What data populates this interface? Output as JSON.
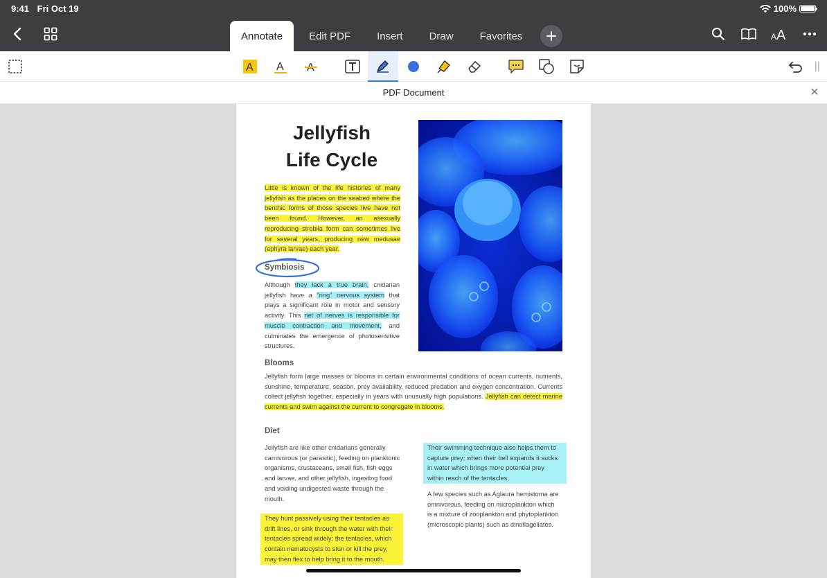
{
  "status": {
    "time": "9:41",
    "date": "Fri Oct 19",
    "battery": "100%"
  },
  "nav": {
    "tabs": [
      {
        "label": "Annotate",
        "active": true
      },
      {
        "label": "Edit PDF"
      },
      {
        "label": "Insert"
      },
      {
        "label": "Draw"
      },
      {
        "label": "Favorites"
      }
    ]
  },
  "docbar": {
    "title": "PDF Document"
  },
  "doc": {
    "title_line1": "Jellyfish",
    "title_line2": "Life Cycle",
    "intro": "Little is known of the life histories of many jellyfish as the places on the seabed where the benthic forms of those species live have not been found. However, an asexually reproducing strobila form can sometimes live for several years, producing new medusae (ephyra larvae) each year.",
    "symbiosis_head": "Symbiosis",
    "sym_a": "Although ",
    "sym_b": "they lack a true brain,",
    "sym_c": " cnidarian jellyfish have a ",
    "sym_d": "\"ring\" nervous system",
    "sym_e": " that plays a significant role in motor and sensory activity. This ",
    "sym_f": "net of nerves is responsible for muscle contraction and movement,",
    "sym_g": " and culminates the emergence of photosensitive structures.",
    "blooms_head": "Blooms",
    "blooms_a": "Jellyfish form large masses or blooms in certain environmental conditions of ocean currents, nutrients, sunshine, temperature, season, prey availability, reduced predation and oxygen concentration. Currents collect jellyfish together, especially in years with unusually high populations. ",
    "blooms_b": "Jellyfish can detect marine currents and swim against the current to congregate in blooms.",
    "diet_head": "Diet",
    "diet_1": "Jellyfish are like other cnidarians generally carnivorous (or parasitic), feeding on planktonic organisms, crustaceans, small fish, fish eggs and larvae, and other jellyfish, ingesting food and voiding undigested waste through the mouth.",
    "diet_2": "They hunt passively using their tentacles as drift lines, or sink through the water with their tentacles spread widely; the tentacles, which contain nematocysts to stun or kill the prey, may then flex to help bring it to the mouth.",
    "diet_3": "Their swimming technique also helps them to capture prey; when their bell expands it sucks in water which brings more potential prey within reach of the tentacles.",
    "diet_4": "A few species such as Aglaura hemistoma are omnivorous, feeding on microplankton which is a mixture of zooplankton and phytoplankton (microscopic plants) such as dinoflagellates."
  },
  "colors": {
    "highlight_yellow": "#fbf338",
    "highlight_cyan": "#9eeff7",
    "accent": "#3a7be0",
    "ink": "#3a6fd8"
  }
}
